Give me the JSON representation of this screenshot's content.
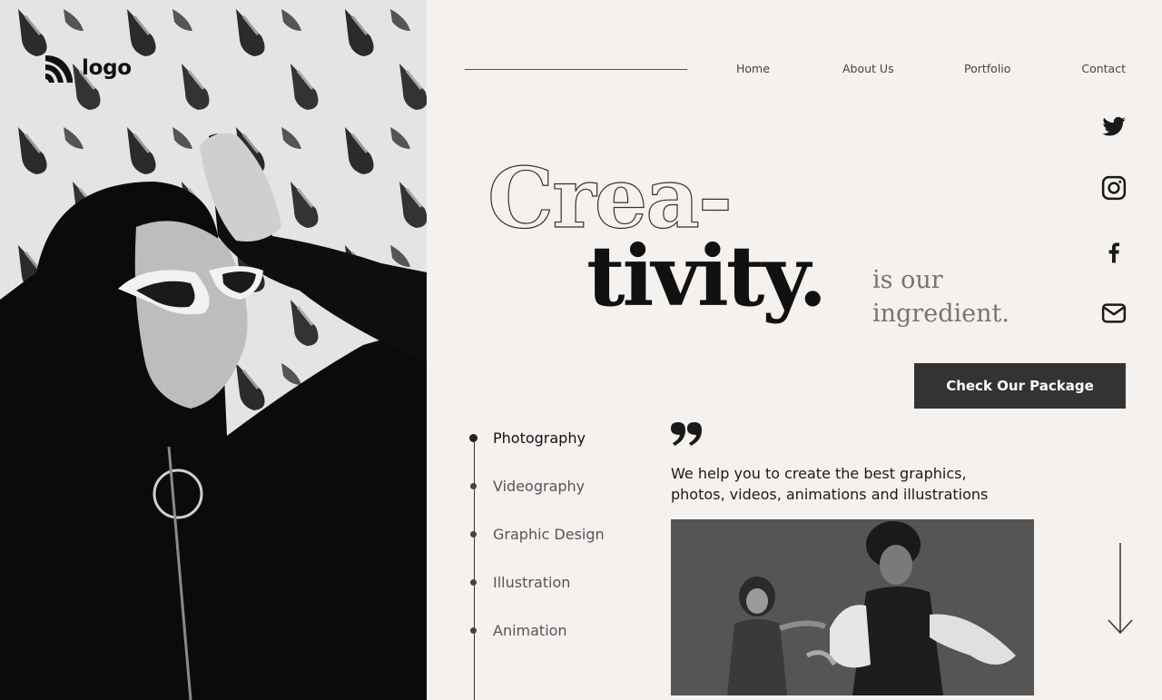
{
  "brand": {
    "logo_text": "logo",
    "logo_icon": "logo-stripes-icon"
  },
  "nav": {
    "items": [
      {
        "label": "Home"
      },
      {
        "label": "About Us"
      },
      {
        "label": "Portfolio"
      },
      {
        "label": "Contact"
      }
    ]
  },
  "social": [
    {
      "icon": "twitter-icon"
    },
    {
      "icon": "instagram-icon"
    },
    {
      "icon": "facebook-icon"
    },
    {
      "icon": "mail-icon"
    }
  ],
  "hero": {
    "headline_outline": "Crea-",
    "headline_solid": "tivity.",
    "tagline_line1": "is our",
    "tagline_line2": "ingredient.",
    "cta_label": "Check Our Package"
  },
  "services": [
    {
      "label": "Photography",
      "active": true
    },
    {
      "label": "Videography",
      "active": false
    },
    {
      "label": "Graphic Design",
      "active": false
    },
    {
      "label": "Illustration",
      "active": false
    },
    {
      "label": "Animation",
      "active": false
    }
  ],
  "description": {
    "quote_icon": "quote-icon",
    "line1": "We help you to create the best graphics,",
    "line2": "photos, videos, animations and illustrations"
  },
  "colors": {
    "background": "#f4f1ee",
    "button": "#333333",
    "text_dark": "#111111",
    "text_muted": "#7a7470"
  }
}
